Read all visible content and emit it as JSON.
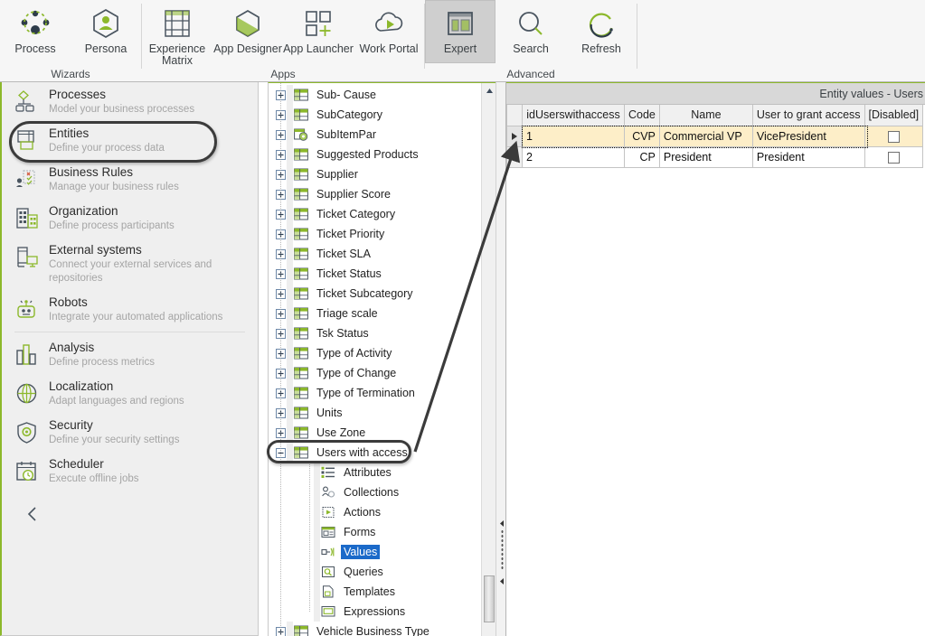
{
  "ribbon": {
    "groups": [
      {
        "label": "Wizards",
        "items": [
          {
            "caption": "Process",
            "icon": "process-icon",
            "selected": false
          },
          {
            "caption": "Persona",
            "icon": "persona-icon",
            "selected": false
          }
        ]
      },
      {
        "label": "Apps",
        "items": [
          {
            "caption": "Experience Matrix",
            "icon": "experience-matrix-icon",
            "selected": false
          },
          {
            "caption": "App Designer",
            "icon": "app-designer-icon",
            "selected": false
          },
          {
            "caption": "App Launcher",
            "icon": "app-launcher-icon",
            "selected": false
          },
          {
            "caption": "Work Portal",
            "icon": "work-portal-icon",
            "selected": false
          }
        ]
      },
      {
        "label": "Advanced",
        "items": [
          {
            "caption": "Expert",
            "icon": "expert-icon",
            "selected": true
          },
          {
            "caption": "Search",
            "icon": "search-icon",
            "selected": false
          },
          {
            "caption": "Refresh",
            "icon": "refresh-icon",
            "selected": false
          }
        ]
      }
    ]
  },
  "sidebar": {
    "items": [
      {
        "title": "Processes",
        "subtitle": "Model your business processes",
        "icon": "processes-icon"
      },
      {
        "title": "Entities",
        "subtitle": "Define your process data",
        "icon": "entities-icon"
      },
      {
        "title": "Business Rules",
        "subtitle": "Manage your business rules",
        "icon": "business-rules-icon"
      },
      {
        "title": "Organization",
        "subtitle": "Define process participants",
        "icon": "organization-icon"
      },
      {
        "title": "External systems",
        "subtitle": "Connect your external services and repositories",
        "icon": "external-systems-icon"
      },
      {
        "title": "Robots",
        "subtitle": "Integrate your automated applications",
        "icon": "robots-icon"
      },
      {
        "title": "Analysis",
        "subtitle": "Define process metrics",
        "icon": "analysis-icon"
      },
      {
        "title": "Localization",
        "subtitle": "Adapt languages and regions",
        "icon": "localization-icon"
      },
      {
        "title": "Security",
        "subtitle": "Define your security settings",
        "icon": "security-icon"
      },
      {
        "title": "Scheduler",
        "subtitle": "Execute offline jobs",
        "icon": "scheduler-icon"
      }
    ],
    "collapse_icon": "chevron-left-icon",
    "highlighted_item": "Entities"
  },
  "tree": {
    "nodes": [
      {
        "label": "Sub- Cause",
        "icon": "entity-icon",
        "expander": "plus",
        "level": 0
      },
      {
        "label": "SubCategory",
        "icon": "entity-icon",
        "expander": "plus",
        "level": 0
      },
      {
        "label": "SubItemPar",
        "icon": "entity-gear-icon",
        "expander": "plus",
        "level": 0
      },
      {
        "label": "Suggested Products",
        "icon": "entity-icon",
        "expander": "plus",
        "level": 0
      },
      {
        "label": "Supplier",
        "icon": "entity-icon",
        "expander": "plus",
        "level": 0
      },
      {
        "label": "Supplier Score",
        "icon": "entity-icon",
        "expander": "plus",
        "level": 0
      },
      {
        "label": "Ticket Category",
        "icon": "entity-icon",
        "expander": "plus",
        "level": 0
      },
      {
        "label": "Ticket Priority",
        "icon": "entity-icon",
        "expander": "plus",
        "level": 0
      },
      {
        "label": "Ticket SLA",
        "icon": "entity-icon",
        "expander": "plus",
        "level": 0
      },
      {
        "label": "Ticket Status",
        "icon": "entity-icon",
        "expander": "plus",
        "level": 0
      },
      {
        "label": "Ticket Subcategory",
        "icon": "entity-icon",
        "expander": "plus",
        "level": 0
      },
      {
        "label": "Triage scale",
        "icon": "entity-icon",
        "expander": "plus",
        "level": 0
      },
      {
        "label": "Tsk Status",
        "icon": "entity-icon",
        "expander": "plus",
        "level": 0
      },
      {
        "label": "Type of Activity",
        "icon": "entity-icon",
        "expander": "plus",
        "level": 0
      },
      {
        "label": "Type of Change",
        "icon": "entity-icon",
        "expander": "plus",
        "level": 0
      },
      {
        "label": "Type of Termination",
        "icon": "entity-icon",
        "expander": "plus",
        "level": 0
      },
      {
        "label": "Units",
        "icon": "entity-icon",
        "expander": "plus",
        "level": 0
      },
      {
        "label": "Use Zone",
        "icon": "entity-icon",
        "expander": "plus",
        "level": 0
      },
      {
        "label": "Users with access",
        "icon": "entity-icon",
        "expander": "minus",
        "level": 0,
        "highlighted": true
      },
      {
        "label": "Attributes",
        "icon": "attributes-icon",
        "expander": "none",
        "level": 1
      },
      {
        "label": "Collections",
        "icon": "collections-icon",
        "expander": "none",
        "level": 1
      },
      {
        "label": "Actions",
        "icon": "actions-icon",
        "expander": "none",
        "level": 1
      },
      {
        "label": "Forms",
        "icon": "forms-icon",
        "expander": "none",
        "level": 1
      },
      {
        "label": "Values",
        "icon": "values-icon",
        "expander": "none",
        "level": 1,
        "selected": true
      },
      {
        "label": "Queries",
        "icon": "queries-icon",
        "expander": "none",
        "level": 1
      },
      {
        "label": "Templates",
        "icon": "templates-icon",
        "expander": "none",
        "level": 1
      },
      {
        "label": "Expressions",
        "icon": "expressions-icon",
        "expander": "none",
        "level": 1
      },
      {
        "label": "Vehicle Business Type",
        "icon": "entity-icon",
        "expander": "plus",
        "level": 0
      }
    ]
  },
  "grid": {
    "caption": "Entity values - Users",
    "columns": [
      "idUserswithaccess",
      "Code",
      "Name",
      "User to grant access",
      "[Disabled]"
    ],
    "rows": [
      {
        "idUserswithaccess": "1",
        "Code": "CVP",
        "Name": "Commercial VP",
        "User to grant access": "VicePresident",
        "Disabled": false,
        "selected": true
      },
      {
        "idUserswithaccess": "2",
        "Code": "CP",
        "Name": "President",
        "User to grant access": "President",
        "Disabled": false,
        "selected": false
      }
    ]
  },
  "annotation": {
    "arrow": "callout-arrow-from-users-with-access-to-row-1",
    "color": "#3b3b3b"
  },
  "colors": {
    "accent_green": "#8cb82b",
    "selection_blue": "#1b6ac9",
    "selected_row": "#fdeec8",
    "ribbon_bg": "#f6f6f6",
    "sidebar_bg": "#efefef"
  }
}
